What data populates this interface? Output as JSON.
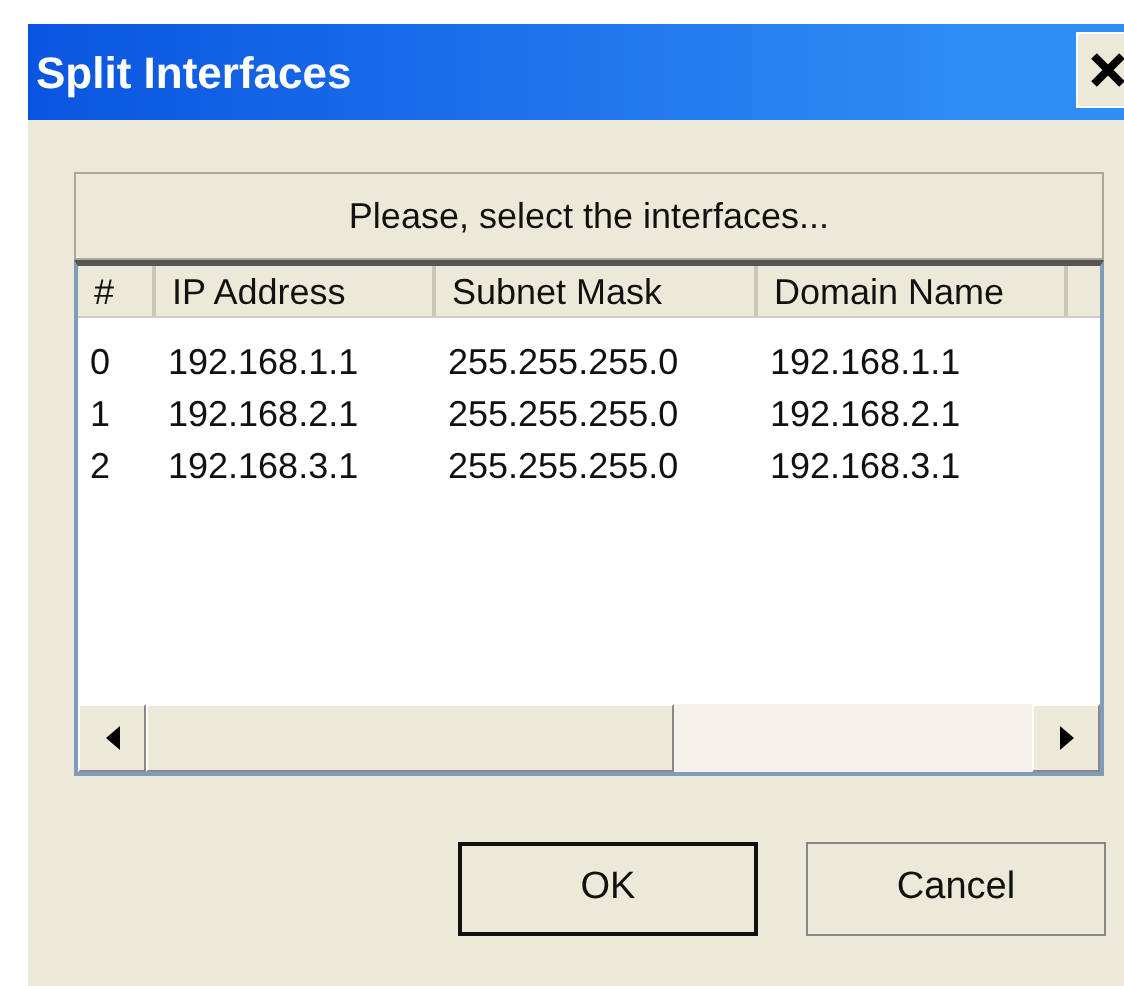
{
  "window": {
    "title": "Split Interfaces"
  },
  "prompt": "Please, select the interfaces...",
  "table": {
    "columns": [
      "#",
      "IP Address",
      "Subnet Mask",
      "Domain Name"
    ],
    "rows": [
      [
        "0",
        "192.168.1.1",
        "255.255.255.0",
        "192.168.1.1"
      ],
      [
        "1",
        "192.168.2.1",
        "255.255.255.0",
        "192.168.2.1"
      ],
      [
        "2",
        "192.168.3.1",
        "255.255.255.0",
        "192.168.3.1"
      ]
    ]
  },
  "buttons": [
    {
      "label": "OK",
      "default": true
    },
    {
      "label": "Cancel",
      "default": false
    }
  ]
}
